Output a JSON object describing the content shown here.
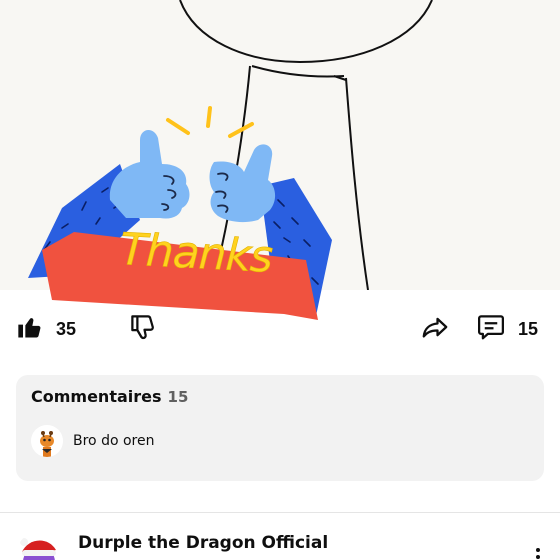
{
  "post": {
    "sticker_text": "Thanks"
  },
  "actions": {
    "like": {
      "icon": "thumb-up-icon",
      "count": "35"
    },
    "dislike": {
      "icon": "thumb-down-icon"
    },
    "share": {
      "icon": "share-icon"
    },
    "comments": {
      "icon": "comment-icon",
      "count": "15"
    }
  },
  "comments": {
    "title": "Commentaires",
    "count": "15",
    "preview_text": "Bro do oren",
    "preview_avatar_icon": "giraffe-avatar-icon"
  },
  "next_post": {
    "channel_name": "Durple the Dragon Official",
    "avatar_icon": "dragon-santa-hat-avatar-icon",
    "menu_icon": "more-vertical-icon"
  },
  "colors": {
    "sticker_banner": "#f0523f",
    "sticker_sleeve": "#2a5fe0",
    "sticker_hand": "#7fb8f5",
    "sticker_text": "#ffd21f",
    "card_background": "#f2f2f2"
  }
}
